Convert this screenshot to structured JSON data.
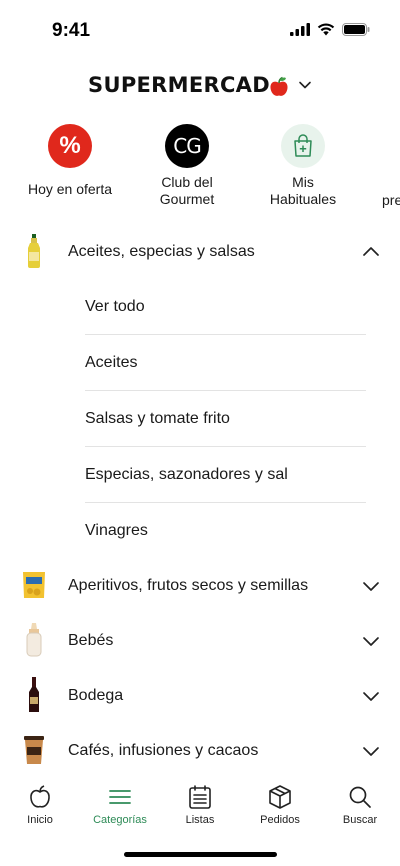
{
  "status": {
    "time": "9:41"
  },
  "brand": {
    "name": "SUPERMERCAD"
  },
  "shortcuts": [
    {
      "label": "Hoy en oferta",
      "icon": "percent-icon",
      "color": "#e0281c"
    },
    {
      "label": "Club del\nGourmet",
      "icon": "cg-logo-icon",
      "color": "#000000"
    },
    {
      "label": "Mis\nHabituales",
      "icon": "shopping-bag-plus-icon",
      "color": "#2e8b57"
    },
    {
      "label": "pre",
      "icon": "partial-shortcut"
    }
  ],
  "categories": {
    "expanded": {
      "label": "Aceites, especias y salsas",
      "thumb": "oil-bottle",
      "sub_items": [
        "Ver todo",
        "Aceites",
        "Salsas y tomate frito",
        "Especias, sazonadores y sal",
        "Vinagres"
      ]
    },
    "items": [
      {
        "label": "Aperitivos, frutos secos y semillas",
        "thumb": "chips-bag"
      },
      {
        "label": "Bebés",
        "thumb": "baby-bottle"
      },
      {
        "label": "Bodega",
        "thumb": "wine-bottle"
      },
      {
        "label": "Cafés, infusiones y cacaos",
        "thumb": "coffee-cup"
      }
    ]
  },
  "tabbar": {
    "tabs": [
      {
        "label": "Inicio",
        "icon": "apple-icon"
      },
      {
        "label": "Categorías",
        "icon": "menu-icon",
        "active": true
      },
      {
        "label": "Listas",
        "icon": "list-icon"
      },
      {
        "label": "Pedidos",
        "icon": "box-icon"
      },
      {
        "label": "Buscar",
        "icon": "search-icon"
      }
    ],
    "active_color": "#2e8b57"
  }
}
